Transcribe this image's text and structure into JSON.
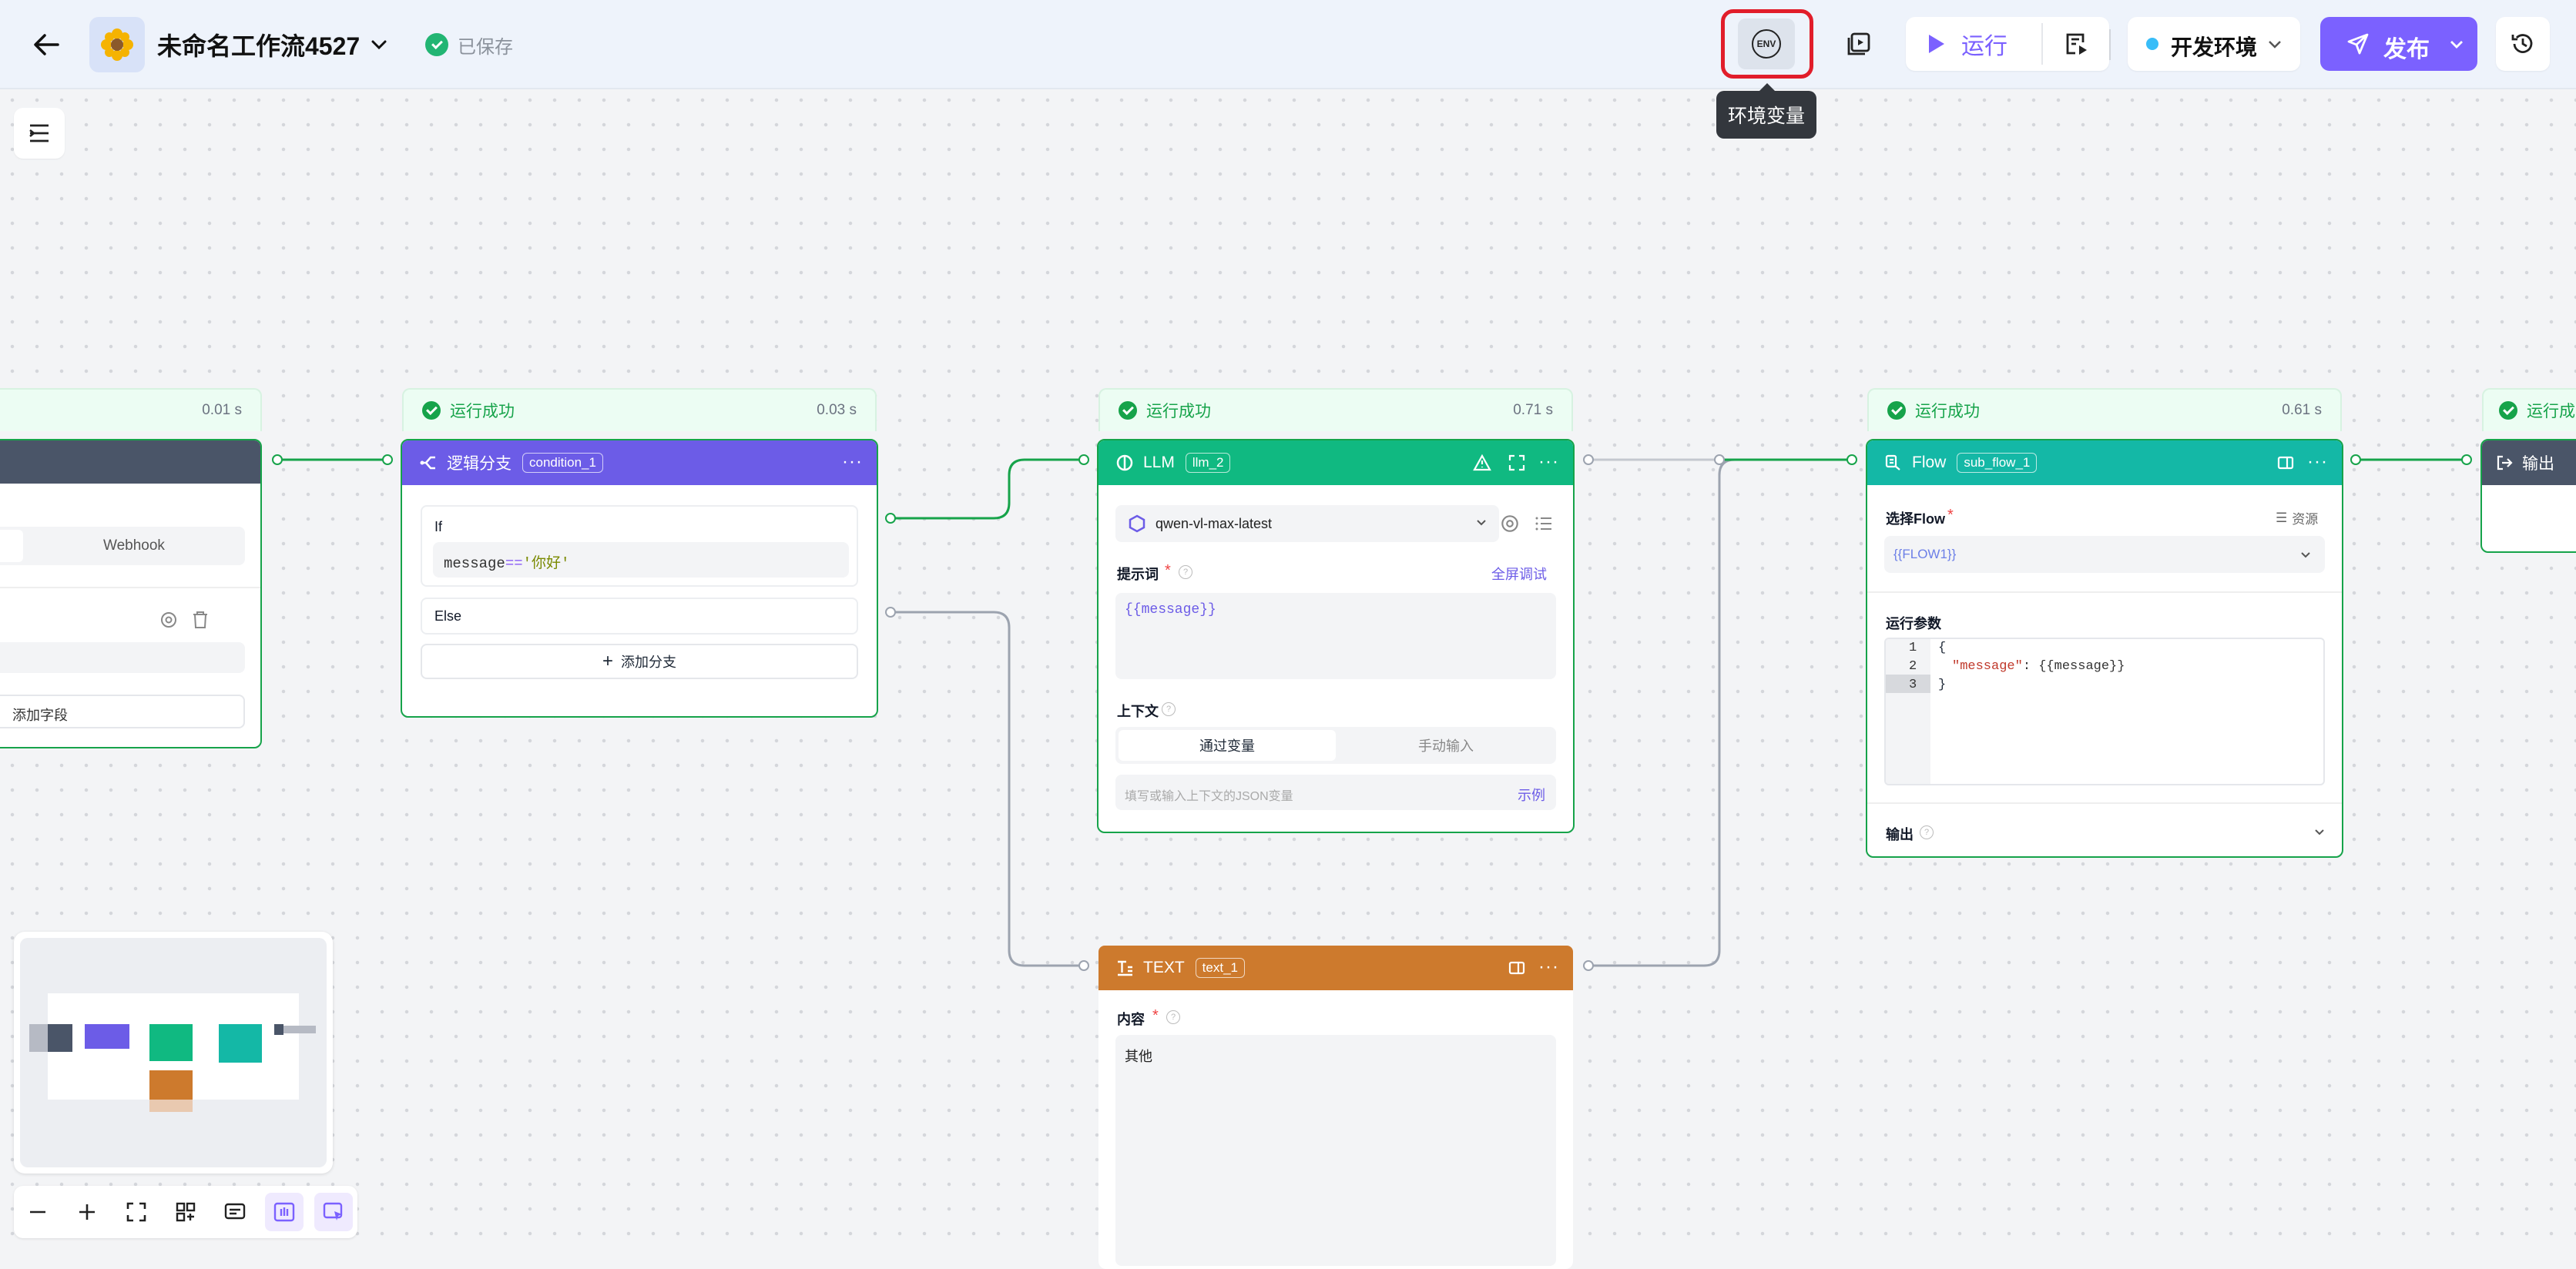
{
  "header": {
    "title": "未命名工作流4527",
    "saved": "已保存",
    "env_button": "ENV",
    "env_tooltip": "环境变量",
    "run": "运行",
    "env_select": "开发环境",
    "publish": "发布"
  },
  "nodes": {
    "start": {
      "time": "0.01 s",
      "tab_webhook": "Webhook",
      "add_field": "添加字段"
    },
    "condition": {
      "status": "运行成功",
      "time": "0.03 s",
      "title": "逻辑分支",
      "id": "condition_1",
      "if_label": "If",
      "expr_var": "message",
      "expr_op": "==",
      "expr_val": "'你好'",
      "else_label": "Else",
      "add_branch": "添加分支"
    },
    "llm": {
      "status": "运行成功",
      "time": "0.71 s",
      "title": "LLM",
      "id": "llm_2",
      "model": "qwen-vl-max-latest",
      "prompt_label": "提示词",
      "fullscreen": "全屏调试",
      "prompt_value": "{{message}}",
      "context_label": "上下文",
      "tab_var": "通过变量",
      "tab_manual": "手动输入",
      "context_placeholder": "填写或输入上下文的JSON变量",
      "example": "示例"
    },
    "text": {
      "title": "TEXT",
      "id": "text_1",
      "content_label": "内容",
      "content_value": "其他"
    },
    "flow": {
      "status": "运行成功",
      "time": "0.61 s",
      "title": "Flow",
      "id": "sub_flow_1",
      "select_label": "选择Flow",
      "resource": "资源",
      "select_value": "{{FLOW1}}",
      "params_label": "运行参数",
      "line1": "1",
      "line2": "2",
      "line3": "3",
      "code1": "{",
      "code2_key": "\"message\"",
      "code2_rest": ": {{message}}",
      "code3": "}",
      "output_label": "输出"
    },
    "output": {
      "status": "运行成",
      "title": "输出"
    }
  },
  "colors": {
    "accent": "#7b61ff",
    "condition": "#6c5ce7",
    "llm": "#10b981",
    "flow": "#14b8a6",
    "text": "#cd7a2d",
    "success": "#16a34a",
    "highlight": "#e11d2a"
  }
}
